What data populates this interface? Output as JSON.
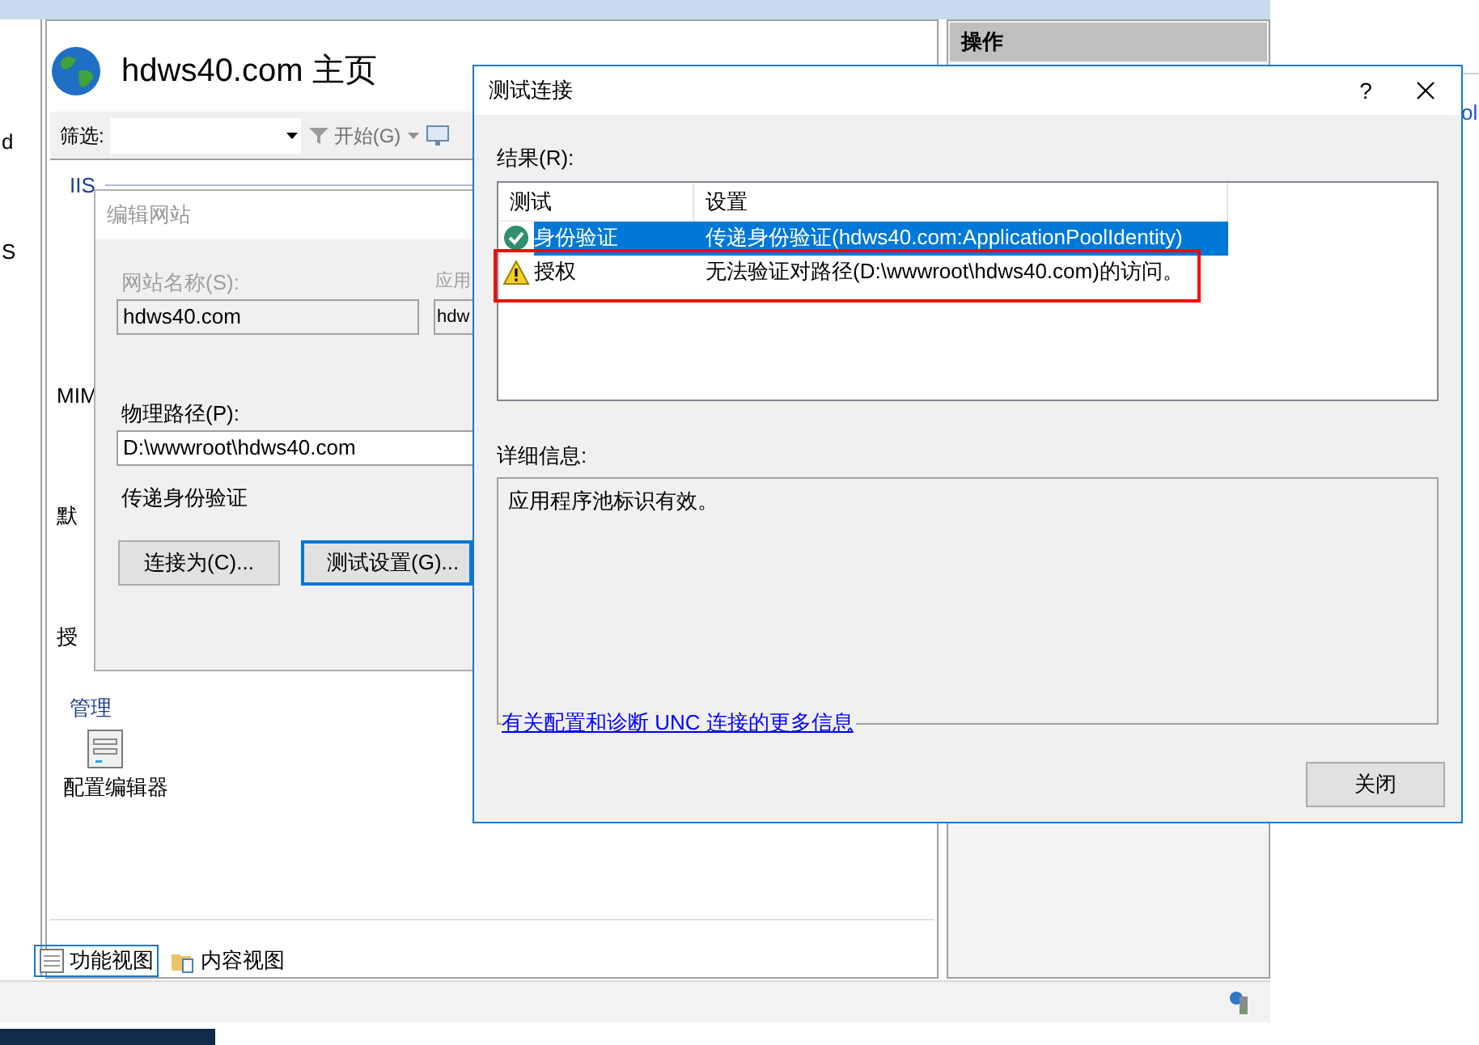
{
  "main_window": {
    "title": "hdws40.com 主页",
    "filter_label": "筛选:",
    "go_button": "开始(G)",
    "tree_fragments": [
      "d",
      "S"
    ],
    "groups": [
      {
        "label": "IIS",
        "kind": "header"
      },
      {
        "label": "MIM",
        "kind": "item"
      },
      {
        "label": "默",
        "kind": "item"
      },
      {
        "label": "授",
        "kind": "item"
      },
      {
        "label": "管理",
        "kind": "header"
      }
    ],
    "feature": "配置编辑器",
    "view_tabs": [
      {
        "label": "功能视图",
        "selected": true
      },
      {
        "label": "内容视图",
        "selected": false
      }
    ],
    "actions_title": "操作",
    "edge_link": "ol"
  },
  "edit_site_dialog": {
    "title": "编辑网站",
    "site_name_label": "网站名称(S):",
    "site_name": "hdws40.com",
    "app_pool_label": "应用",
    "app_pool": "hdw",
    "path_label": "物理路径(P):",
    "path": "D:\\wwwroot\\hdws40.com",
    "auth_label": "传递身份验证",
    "buttons": [
      {
        "label": "连接为(C)...",
        "focused": false
      },
      {
        "label": "测试设置(G)...",
        "focused": true
      }
    ]
  },
  "test_dialog": {
    "title": "测试连接",
    "help": "?",
    "results_label": "结果(R):",
    "columns": [
      "测试",
      "设置"
    ],
    "rows": [
      {
        "test": "身份验证",
        "setting": "传递身份验证(hdws40.com:ApplicationPoolIdentity)",
        "kind": "ok",
        "selected": true,
        "marked": false
      },
      {
        "test": "授权",
        "setting": "无法验证对路径(D:\\wwwroot\\hdws40.com)的访问。",
        "kind": "warning",
        "selected": false,
        "marked": true
      }
    ],
    "details_label": "详细信息:",
    "details": "应用程序池标识有效。",
    "link": "有关配置和诊断 UNC 连接的更多信息",
    "close_button": "关闭"
  }
}
